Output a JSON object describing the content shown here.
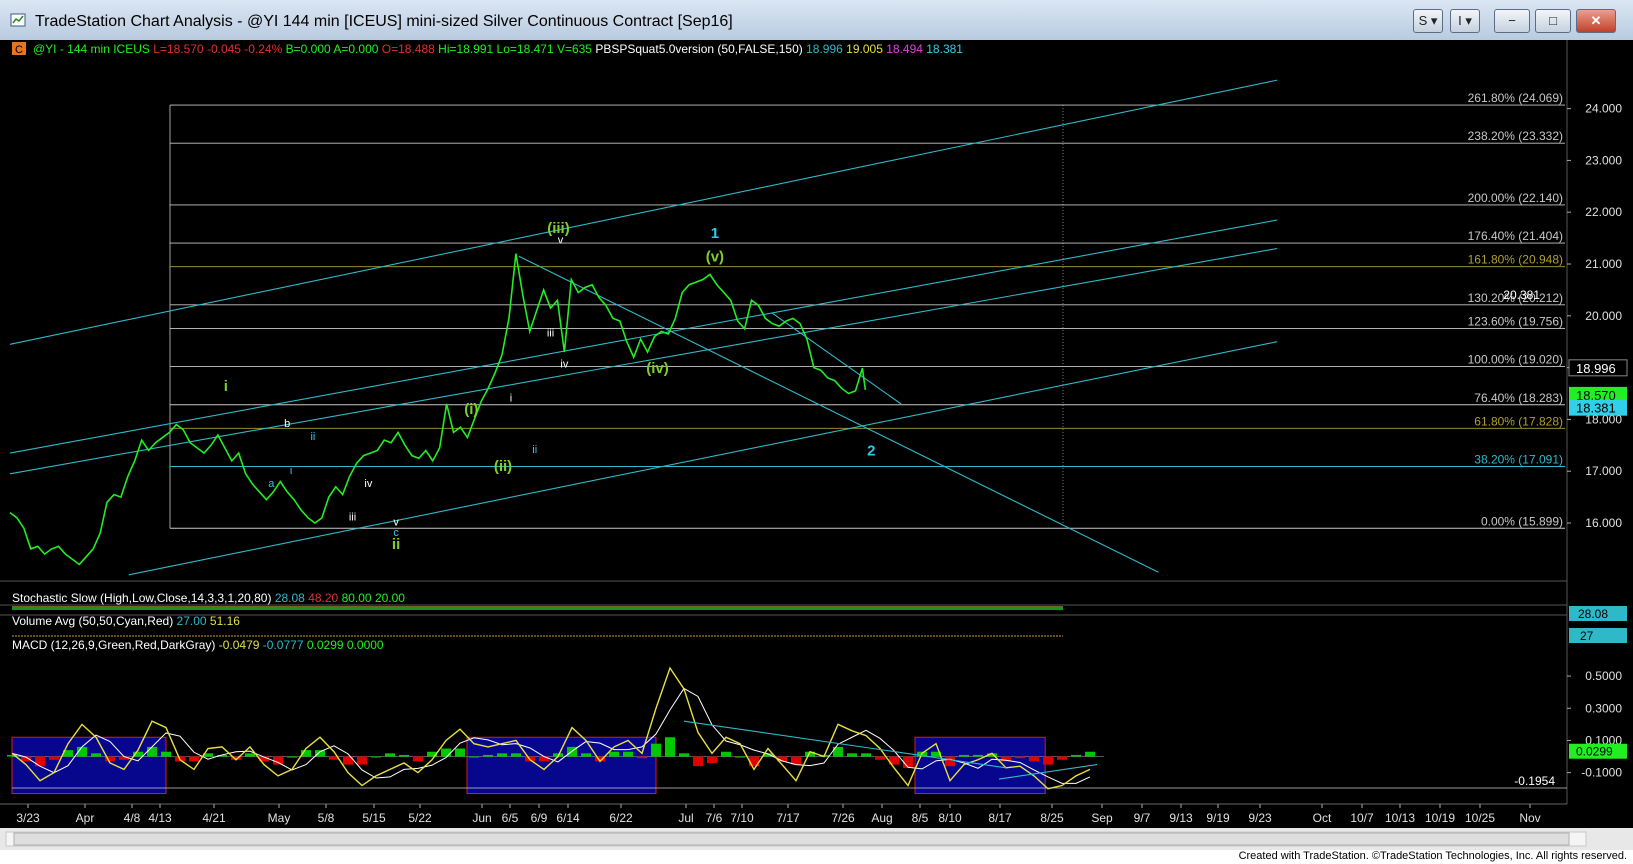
{
  "window": {
    "title": "TradeStation Chart Analysis - @YI 144 min [ICEUS] mini-sized Silver Continuous Contract [Sep16]",
    "buttons": {
      "style": "S",
      "info": "I",
      "minimize": "−",
      "maximize": "□",
      "close": "✕"
    }
  },
  "status_bar": {
    "copyright": "Created with TradeStation. ©TradeStation Technologies, Inc. All rights reserved."
  },
  "colors": {
    "price": "#22ee22",
    "channel": "#2fb9c8",
    "fib_white": "#c8c8c8",
    "fib_olive": "#b0a030",
    "wave_green": "#7dcf2a",
    "wave_cyan": "#30c8f0",
    "macd_up": "#00c800",
    "macd_down": "#e00000",
    "macd_box_fill": "#07078e",
    "macd_box_border": "#d02020"
  },
  "chart_data": {
    "type": "line",
    "header": {
      "badge": "C",
      "symbol": "@YI - 144 min  ICEUS",
      "last": "L=18.570",
      "change": "-0.045",
      "change_pct": "-0.24%",
      "bid": "B=0.000",
      "ask": "A=0.000",
      "open": "O=18.488",
      "high": "Hi=18.991",
      "low": "Lo=18.471",
      "volume": "V=635",
      "study": "PBSPSquat5.0version (50,FALSE,150)",
      "study_values": [
        {
          "text": "18.996",
          "color": "#2fb9c8"
        },
        {
          "text": "19.005",
          "color": "#e0e040"
        },
        {
          "text": "18.494",
          "color": "#e040e0"
        },
        {
          "text": "18.381",
          "color": "#30d0e8"
        }
      ]
    },
    "x_ticks": [
      "3/23",
      "Apr",
      "4/8",
      "4/13",
      "4/21",
      "May",
      "5/8",
      "5/15",
      "5/22",
      "Jun",
      "6/5",
      "6/9",
      "6/14",
      "6/22",
      "Jul",
      "7/6",
      "7/10",
      "7/17",
      "7/26",
      "Aug",
      "8/5",
      "8/10",
      "8/17",
      "8/25",
      "Sep",
      "9/7",
      "9/13",
      "9/19",
      "9/23",
      "Oct",
      "10/7",
      "10/13",
      "10/19",
      "10/25",
      "Nov"
    ],
    "y_ticks": [
      "24.000",
      "23.000",
      "22.000",
      "21.000",
      "20.000",
      "19.000",
      "18.000",
      "17.000",
      "16.000"
    ],
    "ylim": [
      14.9,
      24.9
    ],
    "price_markers": [
      {
        "value": 18.996,
        "label": "18.996",
        "color": "#000000"
      },
      {
        "value": 18.57,
        "label": "18.570",
        "color": "#22ee22"
      },
      {
        "value": 18.381,
        "label": "18.381",
        "color": "#30d0e8"
      }
    ],
    "fib_levels": [
      {
        "label": "261.80% (24.069)",
        "value": 24.069
      },
      {
        "label": "238.20% (23.332)",
        "value": 23.332
      },
      {
        "label": "200.00% (22.140)",
        "value": 22.14
      },
      {
        "label": "176.40% (21.404)",
        "value": 21.404
      },
      {
        "label": "161.80% (20.948)",
        "value": 20.948
      },
      {
        "label": "130.20% (20.212)",
        "value": 20.212
      },
      {
        "label": "123.60% (19.756)",
        "value": 19.756
      },
      {
        "label": "100.00% (19.020)",
        "value": 19.02
      },
      {
        "label": "76.40% (18.283)",
        "value": 18.283
      },
      {
        "label": "61.80% (17.828)",
        "value": 17.828
      },
      {
        "label": "38.20% (17.091)",
        "value": 17.091
      },
      {
        "label": "0.00% (15.899)",
        "value": 15.899
      }
    ],
    "price_label": {
      "text": "20.381",
      "value": 20.381
    },
    "price_series": [
      {
        "x": 0,
        "y": 16.2
      },
      {
        "x": 0.35,
        "y": 16.1
      },
      {
        "x": 0.7,
        "y": 15.9
      },
      {
        "x": 1.05,
        "y": 15.5
      },
      {
        "x": 1.4,
        "y": 15.55
      },
      {
        "x": 1.75,
        "y": 15.4
      },
      {
        "x": 2.1,
        "y": 15.5
      },
      {
        "x": 2.45,
        "y": 15.55
      },
      {
        "x": 2.8,
        "y": 15.4
      },
      {
        "x": 3.15,
        "y": 15.3
      },
      {
        "x": 3.5,
        "y": 15.2
      },
      {
        "x": 3.85,
        "y": 15.35
      },
      {
        "x": 4.2,
        "y": 15.5
      },
      {
        "x": 4.55,
        "y": 15.8
      },
      {
        "x": 4.9,
        "y": 16.4
      },
      {
        "x": 5.25,
        "y": 16.55
      },
      {
        "x": 5.6,
        "y": 16.5
      },
      {
        "x": 5.95,
        "y": 16.9
      },
      {
        "x": 6.3,
        "y": 17.2
      },
      {
        "x": 6.65,
        "y": 17.6
      },
      {
        "x": 7.0,
        "y": 17.4
      },
      {
        "x": 7.35,
        "y": 17.55
      },
      {
        "x": 7.7,
        "y": 17.65
      },
      {
        "x": 8.05,
        "y": 17.75
      },
      {
        "x": 8.4,
        "y": 17.9
      },
      {
        "x": 8.75,
        "y": 17.8
      },
      {
        "x": 9.1,
        "y": 17.55
      },
      {
        "x": 9.45,
        "y": 17.45
      },
      {
        "x": 9.8,
        "y": 17.35
      },
      {
        "x": 10.15,
        "y": 17.5
      },
      {
        "x": 10.5,
        "y": 17.7
      },
      {
        "x": 10.85,
        "y": 17.45
      },
      {
        "x": 11.2,
        "y": 17.2
      },
      {
        "x": 11.55,
        "y": 17.35
      },
      {
        "x": 11.9,
        "y": 16.95
      },
      {
        "x": 12.25,
        "y": 16.75
      },
      {
        "x": 12.6,
        "y": 16.6
      },
      {
        "x": 12.95,
        "y": 16.45
      },
      {
        "x": 13.3,
        "y": 16.6
      },
      {
        "x": 13.65,
        "y": 16.8
      },
      {
        "x": 14.0,
        "y": 16.6
      },
      {
        "x": 14.35,
        "y": 16.45
      },
      {
        "x": 14.7,
        "y": 16.25
      },
      {
        "x": 15.05,
        "y": 16.1
      },
      {
        "x": 15.4,
        "y": 16.0
      },
      {
        "x": 15.75,
        "y": 16.1
      },
      {
        "x": 16.1,
        "y": 16.5
      },
      {
        "x": 16.45,
        "y": 16.7
      },
      {
        "x": 16.8,
        "y": 16.55
      },
      {
        "x": 17.15,
        "y": 16.9
      },
      {
        "x": 17.5,
        "y": 17.15
      },
      {
        "x": 17.85,
        "y": 17.3
      },
      {
        "x": 18.2,
        "y": 17.35
      },
      {
        "x": 18.55,
        "y": 17.4
      },
      {
        "x": 18.9,
        "y": 17.6
      },
      {
        "x": 19.25,
        "y": 17.55
      },
      {
        "x": 19.6,
        "y": 17.75
      },
      {
        "x": 19.95,
        "y": 17.5
      },
      {
        "x": 20.3,
        "y": 17.3
      },
      {
        "x": 20.65,
        "y": 17.25
      },
      {
        "x": 21.0,
        "y": 17.4
      },
      {
        "x": 21.35,
        "y": 17.2
      },
      {
        "x": 21.7,
        "y": 17.45
      },
      {
        "x": 22.05,
        "y": 18.3
      },
      {
        "x": 22.4,
        "y": 17.75
      },
      {
        "x": 22.75,
        "y": 17.85
      },
      {
        "x": 23.1,
        "y": 17.65
      },
      {
        "x": 23.45,
        "y": 18.0
      },
      {
        "x": 23.8,
        "y": 18.35
      },
      {
        "x": 24.15,
        "y": 18.6
      },
      {
        "x": 24.5,
        "y": 18.9
      },
      {
        "x": 24.85,
        "y": 19.25
      },
      {
        "x": 25.2,
        "y": 19.95
      },
      {
        "x": 25.55,
        "y": 21.2
      },
      {
        "x": 25.9,
        "y": 20.4
      },
      {
        "x": 26.25,
        "y": 19.7
      },
      {
        "x": 26.6,
        "y": 20.1
      },
      {
        "x": 26.95,
        "y": 20.5
      },
      {
        "x": 27.3,
        "y": 20.15
      },
      {
        "x": 27.65,
        "y": 20.3
      },
      {
        "x": 28.0,
        "y": 19.3
      },
      {
        "x": 28.35,
        "y": 20.7
      },
      {
        "x": 28.7,
        "y": 20.45
      },
      {
        "x": 29.05,
        "y": 20.55
      },
      {
        "x": 29.4,
        "y": 20.6
      },
      {
        "x": 29.75,
        "y": 20.35
      },
      {
        "x": 30.1,
        "y": 20.2
      },
      {
        "x": 30.45,
        "y": 19.95
      },
      {
        "x": 30.8,
        "y": 19.9
      },
      {
        "x": 31.15,
        "y": 19.5
      },
      {
        "x": 31.5,
        "y": 19.2
      },
      {
        "x": 31.85,
        "y": 19.55
      },
      {
        "x": 32.2,
        "y": 19.3
      },
      {
        "x": 32.55,
        "y": 19.6
      },
      {
        "x": 32.9,
        "y": 19.7
      },
      {
        "x": 33.25,
        "y": 19.65
      },
      {
        "x": 33.6,
        "y": 19.95
      },
      {
        "x": 33.95,
        "y": 20.45
      },
      {
        "x": 34.3,
        "y": 20.6
      },
      {
        "x": 34.65,
        "y": 20.65
      },
      {
        "x": 35.0,
        "y": 20.7
      },
      {
        "x": 35.35,
        "y": 20.8
      },
      {
        "x": 35.7,
        "y": 20.6
      },
      {
        "x": 36.05,
        "y": 20.45
      },
      {
        "x": 36.4,
        "y": 20.3
      },
      {
        "x": 36.75,
        "y": 19.9
      },
      {
        "x": 37.1,
        "y": 19.75
      },
      {
        "x": 37.45,
        "y": 20.3
      },
      {
        "x": 37.8,
        "y": 20.2
      },
      {
        "x": 38.15,
        "y": 19.95
      },
      {
        "x": 38.5,
        "y": 19.85
      },
      {
        "x": 38.85,
        "y": 19.8
      },
      {
        "x": 39.2,
        "y": 19.9
      },
      {
        "x": 39.55,
        "y": 19.95
      },
      {
        "x": 39.9,
        "y": 19.85
      },
      {
        "x": 40.25,
        "y": 19.55
      },
      {
        "x": 40.6,
        "y": 19.0
      },
      {
        "x": 40.95,
        "y": 18.95
      },
      {
        "x": 41.3,
        "y": 18.8
      },
      {
        "x": 41.65,
        "y": 18.75
      },
      {
        "x": 42.0,
        "y": 18.6
      },
      {
        "x": 42.35,
        "y": 18.5
      },
      {
        "x": 42.7,
        "y": 18.55
      },
      {
        "x": 43.05,
        "y": 18.99
      },
      {
        "x": 43.2,
        "y": 18.57
      }
    ],
    "channel_lines": [
      {
        "x1": 0,
        "y1": 19.45,
        "x2": 64,
        "y2": 24.55
      },
      {
        "x1": 0,
        "y1": 17.35,
        "x2": 64,
        "y2": 21.85
      },
      {
        "x1": 0,
        "y1": 16.95,
        "x2": 64,
        "y2": 21.3
      },
      {
        "x1": 6,
        "y1": 15.0,
        "x2": 64,
        "y2": 19.5
      },
      {
        "x1": 25.7,
        "y1": 21.15,
        "x2": 58,
        "y2": 15.05
      },
      {
        "x1": 38.5,
        "y1": 20.05,
        "x2": 45,
        "y2": 18.3
      }
    ],
    "wave_labels": [
      {
        "text": "i",
        "x": 10.9,
        "y": 18.55,
        "color": "green",
        "size": "big"
      },
      {
        "text": "ii",
        "x": 19.5,
        "y": 15.5,
        "color": "green",
        "size": "big"
      },
      {
        "text": "(i)",
        "x": 23.3,
        "y": 18.1,
        "color": "green",
        "size": "big"
      },
      {
        "text": "(ii)",
        "x": 24.9,
        "y": 17.0,
        "color": "green",
        "size": "big"
      },
      {
        "text": "(iii)",
        "x": 27.7,
        "y": 21.6,
        "color": "green",
        "size": "big"
      },
      {
        "text": "(iv)",
        "x": 32.7,
        "y": 18.9,
        "color": "green",
        "size": "big"
      },
      {
        "text": "(v)",
        "x": 35.6,
        "y": 21.05,
        "color": "green",
        "size": "big"
      },
      {
        "text": "1",
        "x": 35.6,
        "y": 21.5,
        "color": "cyan",
        "size": "big"
      },
      {
        "text": "2",
        "x": 43.5,
        "y": 17.3,
        "color": "cyan",
        "size": "big"
      },
      {
        "text": "a",
        "x": 13.2,
        "y": 16.7,
        "color": "cyan",
        "size": "small"
      },
      {
        "text": "b",
        "x": 14.0,
        "y": 17.85,
        "color": "white",
        "size": "small"
      },
      {
        "text": "i",
        "x": 14.2,
        "y": 16.95,
        "color": "cyan",
        "size": "small"
      },
      {
        "text": "ii",
        "x": 15.3,
        "y": 17.6,
        "color": "cyan",
        "size": "small"
      },
      {
        "text": "iii",
        "x": 17.3,
        "y": 16.05,
        "color": "white",
        "size": "small"
      },
      {
        "text": "iv",
        "x": 18.1,
        "y": 16.7,
        "color": "white",
        "size": "small"
      },
      {
        "text": "v",
        "x": 19.5,
        "y": 15.95,
        "color": "white",
        "size": "small"
      },
      {
        "text": "c",
        "x": 19.5,
        "y": 15.75,
        "color": "cyan",
        "size": "small"
      },
      {
        "text": "i",
        "x": 25.3,
        "y": 18.35,
        "color": "white",
        "size": "small"
      },
      {
        "text": "ii",
        "x": 26.5,
        "y": 17.35,
        "color": "cyan",
        "size": "small"
      },
      {
        "text": "iii",
        "x": 27.3,
        "y": 19.6,
        "color": "white",
        "size": "small"
      },
      {
        "text": "iv",
        "x": 28.0,
        "y": 19.0,
        "color": "white",
        "size": "small"
      },
      {
        "text": "v",
        "x": 27.8,
        "y": 21.4,
        "color": "white",
        "size": "small"
      }
    ],
    "stochastic": {
      "label": "Stochastic Slow (High,Low,Close,14,3,3,1,20,80)",
      "values": [
        "28.08",
        "48.20",
        "80.00",
        "20.00"
      ],
      "axis_value": "28.08"
    },
    "volume": {
      "label": "Volume Avg (50,50,Cyan,Red)",
      "values": [
        "27.00",
        "51.16"
      ],
      "axis_value": "27"
    },
    "macd": {
      "label": "MACD (12,26,9,Green,Red,DarkGray)",
      "values": [
        "-0.0479",
        "-0.0777",
        "0.0299",
        "0.0000"
      ],
      "y_ticks": [
        "0.5000",
        "0.3000",
        "0.1000",
        "-0.1000"
      ],
      "ylim": [
        -0.27,
        0.6
      ],
      "current": {
        "value": 0.0299,
        "label": "0.0299"
      },
      "min_label": {
        "text": "-0.1954",
        "value": -0.1954
      },
      "macd_series": [
        0.02,
        -0.05,
        -0.15,
        -0.1,
        0.08,
        0.2,
        0.12,
        -0.04,
        -0.08,
        0.04,
        0.22,
        0.18,
        -0.02,
        -0.08,
        0.05,
        0.06,
        -0.02,
        0.06,
        -0.05,
        -0.12,
        -0.08,
        0.05,
        0.12,
        0.03,
        -0.1,
        -0.18,
        -0.12,
        -0.08,
        -0.04,
        -0.1,
        -0.02,
        0.1,
        0.17,
        0.08,
        0.06,
        0.08,
        0.1,
        -0.02,
        -0.08,
        0.0,
        0.18,
        0.1,
        -0.03,
        0.06,
        0.1,
        0.02,
        0.3,
        0.55,
        0.42,
        0.15,
        0.02,
        0.12,
        0.08,
        -0.08,
        0.05,
        -0.05,
        -0.15,
        0.03,
        0.0,
        0.2,
        0.16,
        0.13,
        0.05,
        -0.07,
        -0.18,
        0.02,
        0.08,
        -0.15,
        -0.05,
        -0.02,
        0.02,
        -0.07,
        -0.06,
        -0.12,
        -0.2,
        -0.18,
        -0.12,
        -0.08
      ],
      "hist_series": [
        0.01,
        -0.03,
        -0.06,
        -0.02,
        0.04,
        0.06,
        0.02,
        -0.03,
        -0.02,
        0.03,
        0.06,
        0.03,
        -0.03,
        -0.03,
        0.02,
        0.01,
        -0.02,
        0.02,
        -0.03,
        -0.05,
        0.0,
        0.04,
        0.04,
        -0.02,
        -0.05,
        -0.05,
        0.0,
        0.02,
        0.01,
        -0.03,
        0.03,
        0.05,
        0.05,
        0.0,
        0.01,
        0.02,
        0.02,
        -0.03,
        -0.03,
        0.02,
        0.06,
        0.02,
        -0.03,
        0.03,
        0.03,
        -0.01,
        0.08,
        0.12,
        0.02,
        -0.06,
        -0.04,
        0.03,
        0.0,
        -0.06,
        0.02,
        -0.03,
        -0.05,
        0.03,
        0.01,
        0.06,
        0.02,
        0.02,
        -0.02,
        -0.05,
        -0.07,
        0.03,
        0.03,
        -0.06,
        0.01,
        0.01,
        0.02,
        -0.03,
        -0.01,
        -0.03,
        -0.05,
        -0.02,
        0.01,
        0.03
      ],
      "boxes": [
        [
          0,
          11.0
        ],
        [
          32.5,
          46.0
        ],
        [
          64.5,
          73.8
        ]
      ],
      "trend_lines": [
        {
          "x1": 48,
          "y1": 0.22,
          "x2": 71,
          "y2": -0.07
        },
        {
          "x1": 70.5,
          "y1": -0.14,
          "x2": 77.5,
          "y2": -0.05
        }
      ]
    }
  }
}
